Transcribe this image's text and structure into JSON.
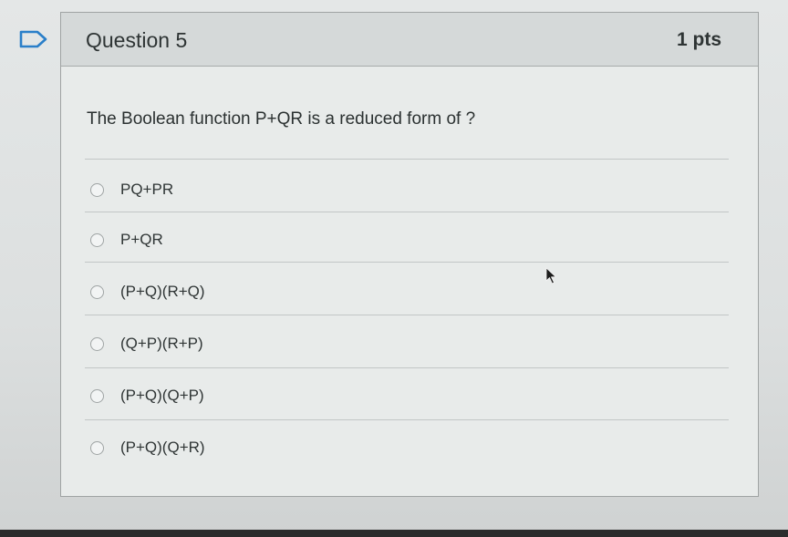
{
  "question": {
    "title": "Question 5",
    "points": "1 pts",
    "text": "The Boolean function P+QR is a reduced form of ?",
    "answers": [
      {
        "label": "PQ+PR"
      },
      {
        "label": "P+QR"
      },
      {
        "label": "(P+Q)(R+Q)"
      },
      {
        "label": "(Q+P)(R+P)"
      },
      {
        "label": "(P+Q)(Q+P)"
      },
      {
        "label": "(P+Q)(Q+R)"
      }
    ]
  },
  "icons": {
    "flag": "bookmark-flag-icon",
    "cursor": "mouse-pointer-icon"
  },
  "colors": {
    "accent": "#2a7fc9",
    "header_bg": "#d5d9d9",
    "card_bg": "#e8ebea"
  }
}
